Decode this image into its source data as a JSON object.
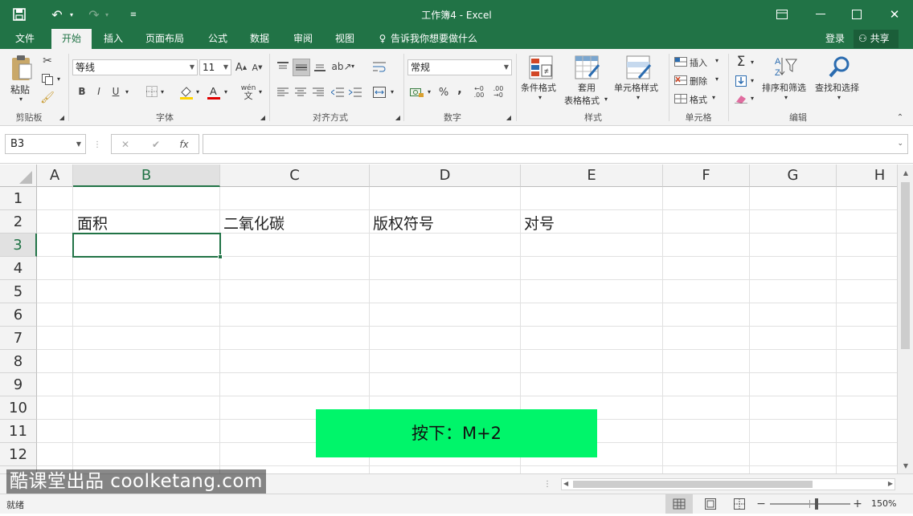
{
  "titlebar": {
    "title": "工作簿4 - Excel",
    "save_icon": "save-icon",
    "undo_icon": "undo-icon",
    "redo_icon": "redo-icon",
    "customize_icon": "customize-icon"
  },
  "menu": {
    "tabs": [
      "文件",
      "开始",
      "插入",
      "页面布局",
      "公式",
      "数据",
      "审阅",
      "视图"
    ],
    "active": "开始",
    "tellme": "告诉我你想要做什么",
    "login": "登录",
    "share": "共享"
  },
  "ribbon": {
    "clipboard": {
      "paste": "粘贴",
      "group": "剪贴板"
    },
    "font": {
      "name": "等线",
      "size": "11",
      "bold": "B",
      "italic": "I",
      "underline": "U",
      "group": "字体"
    },
    "alignment": {
      "group": "对齐方式"
    },
    "number": {
      "format": "常规",
      "percent": "%",
      "comma": ",",
      "group": "数字"
    },
    "styles": {
      "conditional": "条件格式",
      "table1": "套用",
      "table2": "表格格式",
      "cellstyle": "单元格样式",
      "group": "样式"
    },
    "cells": {
      "insert": "插入",
      "delete": "删除",
      "format": "格式",
      "group": "单元格"
    },
    "editing": {
      "sort": "排序和筛选",
      "find": "查找和选择",
      "group": "编辑"
    }
  },
  "formula_bar": {
    "name_box": "B3",
    "cancel": "✕",
    "enter": "✔",
    "fx": "fx",
    "formula": ""
  },
  "sheet": {
    "columns": [
      "A",
      "B",
      "C",
      "D",
      "E",
      "F",
      "G",
      "H"
    ],
    "selected_column": "B",
    "rows": [
      "1",
      "2",
      "3",
      "4",
      "5",
      "6",
      "7",
      "8",
      "9",
      "10",
      "11",
      "12"
    ],
    "selected_row": "3",
    "cells": {
      "B2": "面积",
      "C2": "二氧化碳",
      "D2": "版权符号",
      "E2": "对号"
    },
    "active_cell": "B3"
  },
  "overlay": {
    "text": "按下：M+2"
  },
  "watermark": {
    "text": "酷课堂出品 coolketang.com"
  },
  "status": {
    "ready": "就绪",
    "zoom": "150%",
    "zoom_level": 150
  },
  "colors": {
    "excel_green": "#217346",
    "overlay_green": "#00f56a"
  }
}
